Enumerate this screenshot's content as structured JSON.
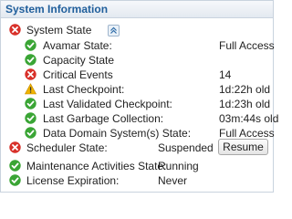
{
  "panel": {
    "title": "System Information"
  },
  "system_state": {
    "label": "System State",
    "status_icon": "error-icon",
    "expand_icon": "collapse-up-icon",
    "items": [
      {
        "label": "Avamar State:",
        "value": "Full Access",
        "status_icon": "ok-icon"
      },
      {
        "label": "Capacity State",
        "value": "",
        "status_icon": "ok-icon"
      },
      {
        "label": "Critical Events",
        "value": "14",
        "status_icon": "error-icon"
      },
      {
        "label": "Last Checkpoint:",
        "value": "1d:22h old",
        "status_icon": "warning-icon"
      },
      {
        "label": "Last Validated Checkpoint:",
        "value": "1d:23h old",
        "status_icon": "ok-icon"
      },
      {
        "label": "Last Garbage Collection:",
        "value": "03m:44s old",
        "status_icon": "ok-icon"
      },
      {
        "label": "Data Domain System(s) State:",
        "value": "Full Access",
        "status_icon": "ok-icon"
      }
    ]
  },
  "scheduler": {
    "label": "Scheduler State:",
    "value": "Suspended",
    "status_icon": "error-icon",
    "button_label": "Resume"
  },
  "maintenance": {
    "label": "Maintenance Activities State:",
    "value": "Running",
    "status_icon": "ok-icon"
  },
  "license": {
    "label": "License Expiration:",
    "value": "Never",
    "status_icon": "ok-icon"
  },
  "colors": {
    "ok": "#3aa535",
    "error": "#d8312a",
    "warning": "#f0b400",
    "header_text": "#1f5e9b"
  }
}
